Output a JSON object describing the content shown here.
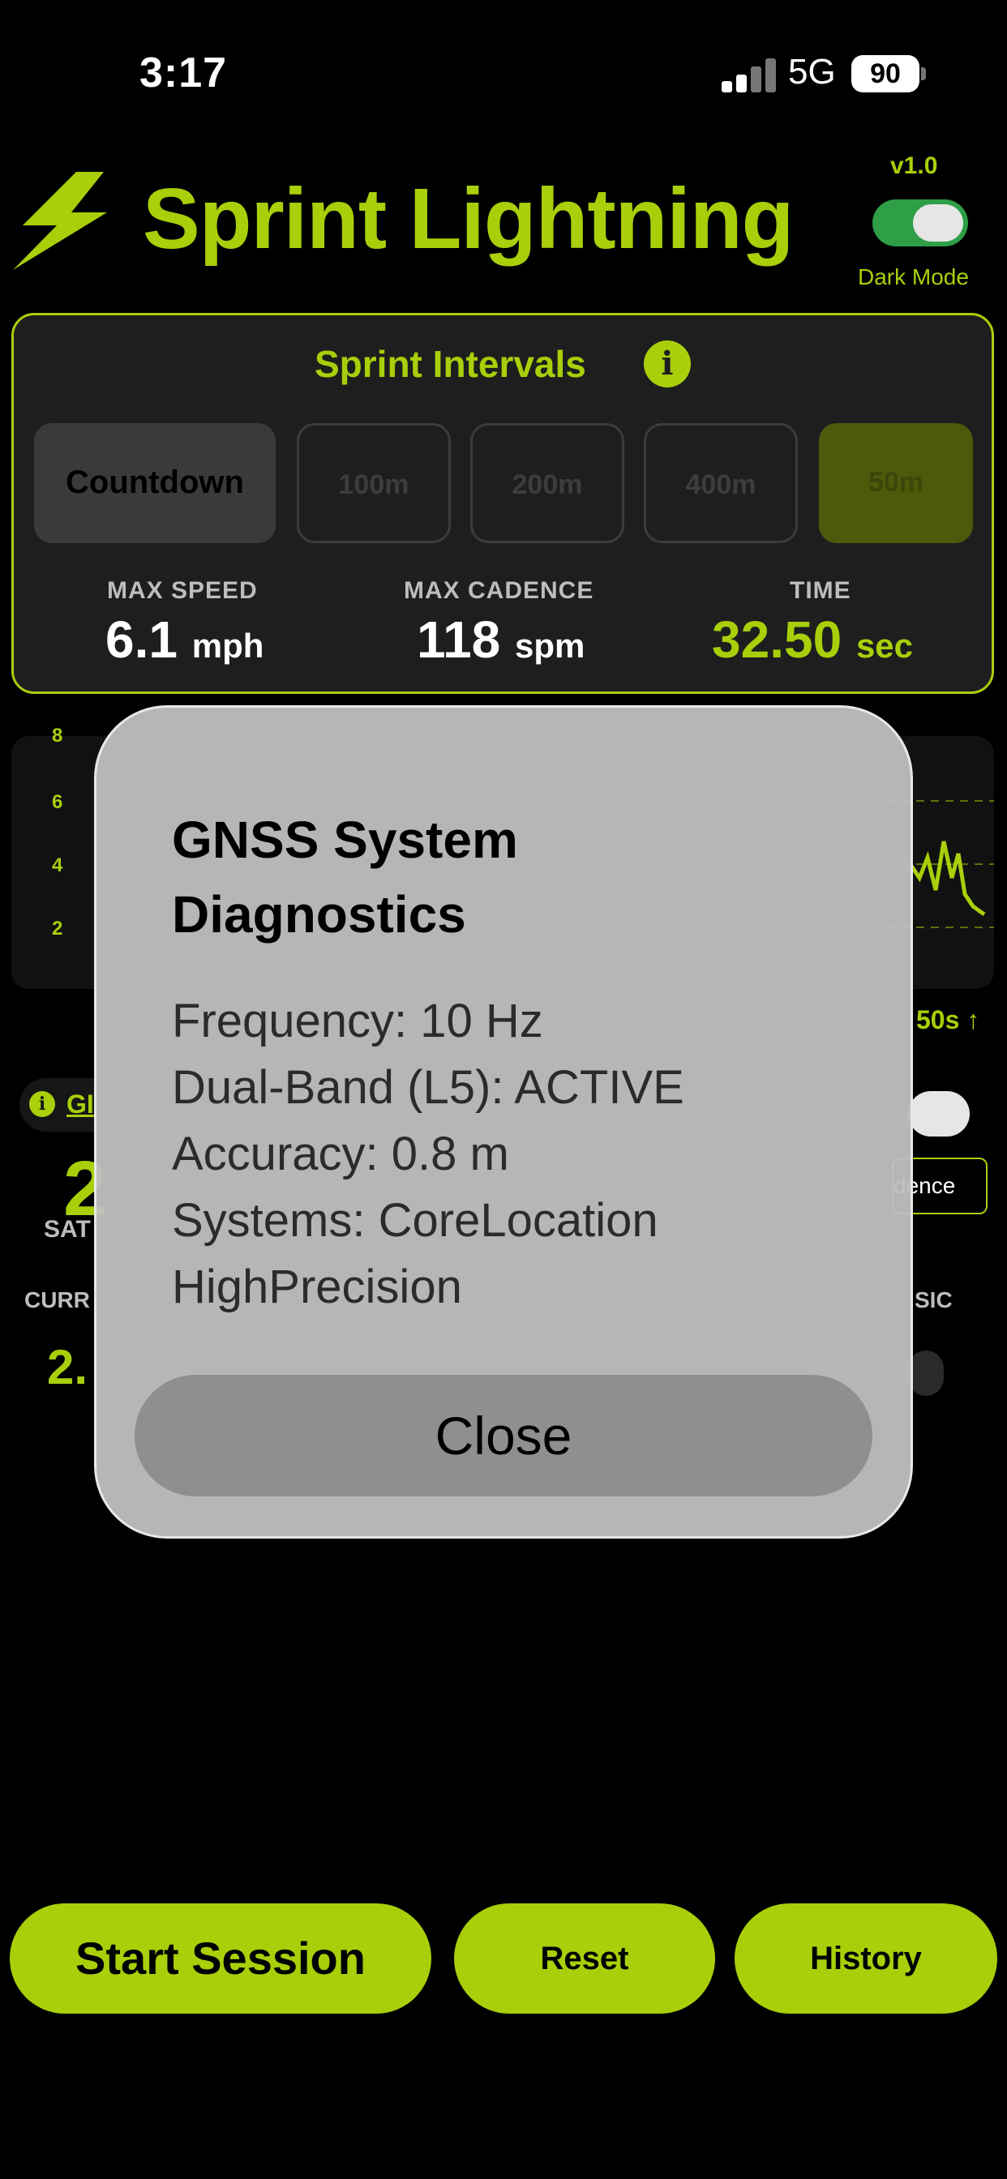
{
  "status_bar": {
    "time": "3:17",
    "network": "5G",
    "battery": "90"
  },
  "header": {
    "title": "Sprint Lightning",
    "version": "v1.0",
    "dark_mode_label": "Dark Mode",
    "dark_mode_on": true
  },
  "panel": {
    "title": "Sprint Intervals",
    "segments": [
      "Countdown",
      "100m",
      "200m",
      "400m",
      "50m"
    ],
    "stats": [
      {
        "label": "MAX SPEED",
        "value": "6.1",
        "unit": "mph"
      },
      {
        "label": "MAX CADENCE",
        "value": "118",
        "unit": "spm"
      },
      {
        "label": "TIME",
        "value": "32.50",
        "unit": "sec"
      }
    ]
  },
  "background": {
    "chart_ticks": [
      "8",
      "6",
      "4",
      "2"
    ],
    "chart_xlabel": "50s ↑",
    "gps_chip": "GI",
    "sat_count": "2",
    "sat_label": "SAT",
    "curr_label": "CURR",
    "curr_value": "2.",
    "music_label": "SIC",
    "cadence_button": "dence"
  },
  "modal": {
    "title": "GNSS System Diagnostics",
    "lines": [
      "Frequency: 10 Hz",
      "Dual-Band (L5): ACTIVE",
      "Accuracy: 0.8 m",
      "Systems: CoreLocation",
      "HighPrecision"
    ],
    "close_label": "Close"
  },
  "actions": {
    "start": "Start Session",
    "reset": "Reset",
    "history": "History"
  },
  "colors": {
    "accent": "#a8cf0a",
    "background": "#000000",
    "panel": "#1e1e1e",
    "modal": "#c0c0c0",
    "toggle_on": "#2e9e47"
  }
}
